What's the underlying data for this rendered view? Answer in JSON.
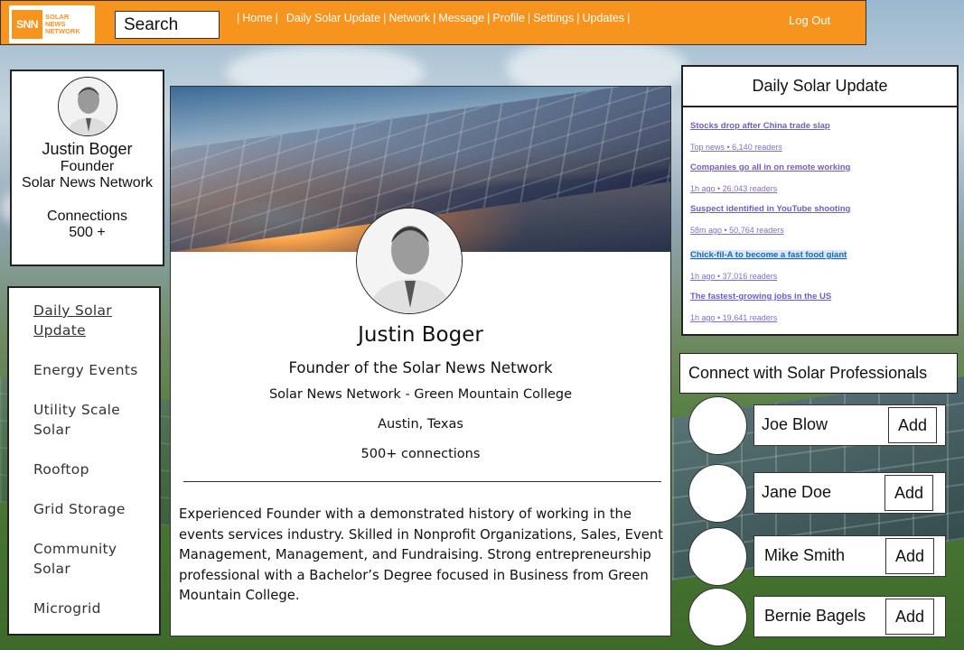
{
  "header": {
    "logo_mark": "SNN",
    "logo_text": [
      "SOLAR",
      "NEWS",
      "NETWORK"
    ],
    "search_label": "Search",
    "nav": [
      "Home",
      "Daily Solar Update",
      "Network",
      "Message",
      "Profile",
      "Settings",
      "Updates"
    ],
    "logout": "Log Out"
  },
  "profile_card": {
    "name": "Justin Boger",
    "role": "Founder",
    "company": "Solar News Network",
    "connections_label": "Connections",
    "connections_value": "500 +"
  },
  "menu": {
    "items": [
      "Daily Solar Update",
      "Energy Events",
      "Utility Scale Solar",
      "Rooftop",
      "Grid Storage",
      "Community Solar",
      "Microgrid"
    ]
  },
  "main": {
    "name": "Justin Boger",
    "title": "Founder of the Solar News Network",
    "school": "Solar News Network - Green Mountain College",
    "location": "Austin, Texas",
    "connections": "500+ connections",
    "bio": "Experienced Founder with a demonstrated history of working in the events services industry. Skilled in Nonprofit Organizations, Sales, Event Management, Management, and Fundraising. Strong entrepreneurship professional with a Bachelor’s Degree focused in Business from Green Mountain College."
  },
  "news": {
    "title": "Daily Solar Update",
    "items": [
      {
        "headline": "Stocks drop after China trade slap",
        "meta": "Top news • 6,140 readers"
      },
      {
        "headline": "Companies go all in on remote working",
        "meta": "1h ago • 26,043 readers"
      },
      {
        "headline": "Suspect identified in YouTube shooting",
        "meta": "58m ago • 50,764 readers"
      },
      {
        "headline": "Chick-fil-A to become a fast food giant",
        "meta": "1h ago • 37,016 readers"
      },
      {
        "headline": "The fastest-growing jobs in the US",
        "meta": "1h ago • 19,641 readers"
      }
    ]
  },
  "connect": {
    "title": "Connect with Solar Professionals",
    "add_label": "Add",
    "people": [
      "Joe Blow",
      "Jane Doe",
      "Mike Smith",
      "Bernie Bagels"
    ]
  },
  "colors": {
    "header": "#f7941d",
    "link": "#6c5dd3"
  }
}
